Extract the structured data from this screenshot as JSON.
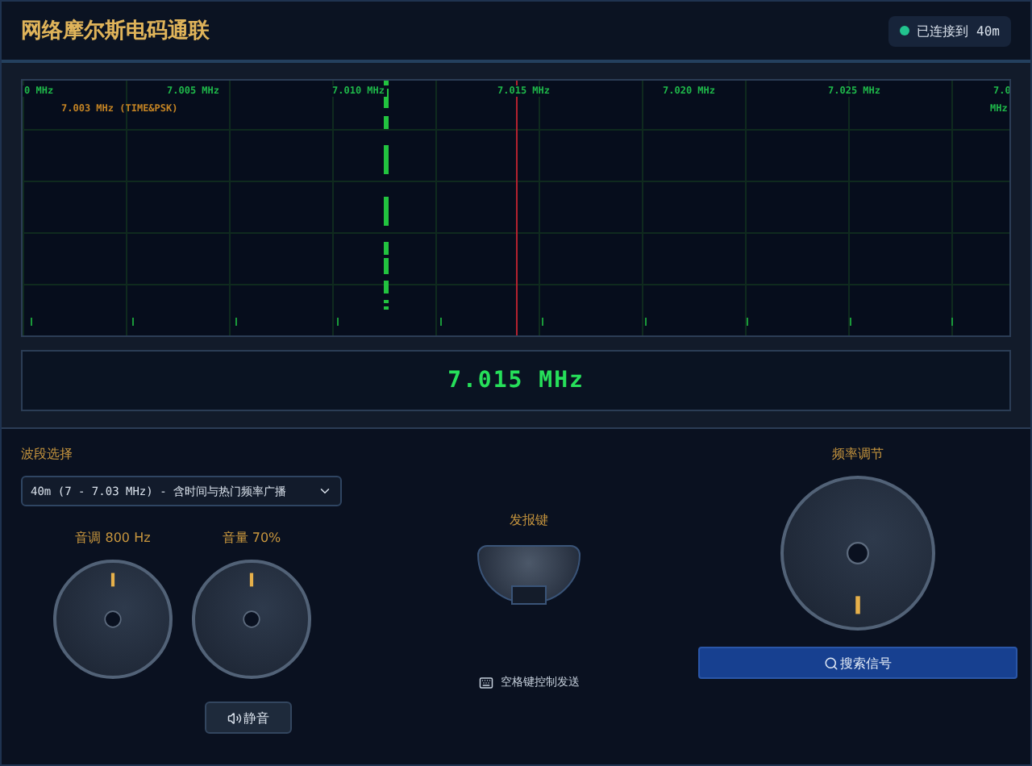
{
  "header": {
    "title": "网络摩尔斯电码通联",
    "status": {
      "text": "已连接到 40m",
      "connected": true
    }
  },
  "waterfall": {
    "axis_labels": [
      "0 MHz",
      "7.005 MHz",
      "7.010 MHz",
      "7.015 MHz",
      "7.020 MHz",
      "7.025 MHz",
      "7.0"
    ],
    "axis_overflow": "MHz",
    "station_label": "7.003 MHz (TIME&PSK)"
  },
  "frequency_display": "7.015 MHz",
  "band": {
    "label": "波段选择",
    "value": "40m (7 - 7.03 MHz) - 含时间与热门频率广播"
  },
  "knobs": [
    {
      "label": "音调",
      "reading": "800 Hz"
    },
    {
      "label": "音量",
      "reading": "70%"
    }
  ],
  "mute_button": "静音",
  "key": {
    "label": "发报键",
    "hint": "空格键控制发送"
  },
  "tuning": {
    "label": "频率调节"
  },
  "search_button": "搜索信号"
}
